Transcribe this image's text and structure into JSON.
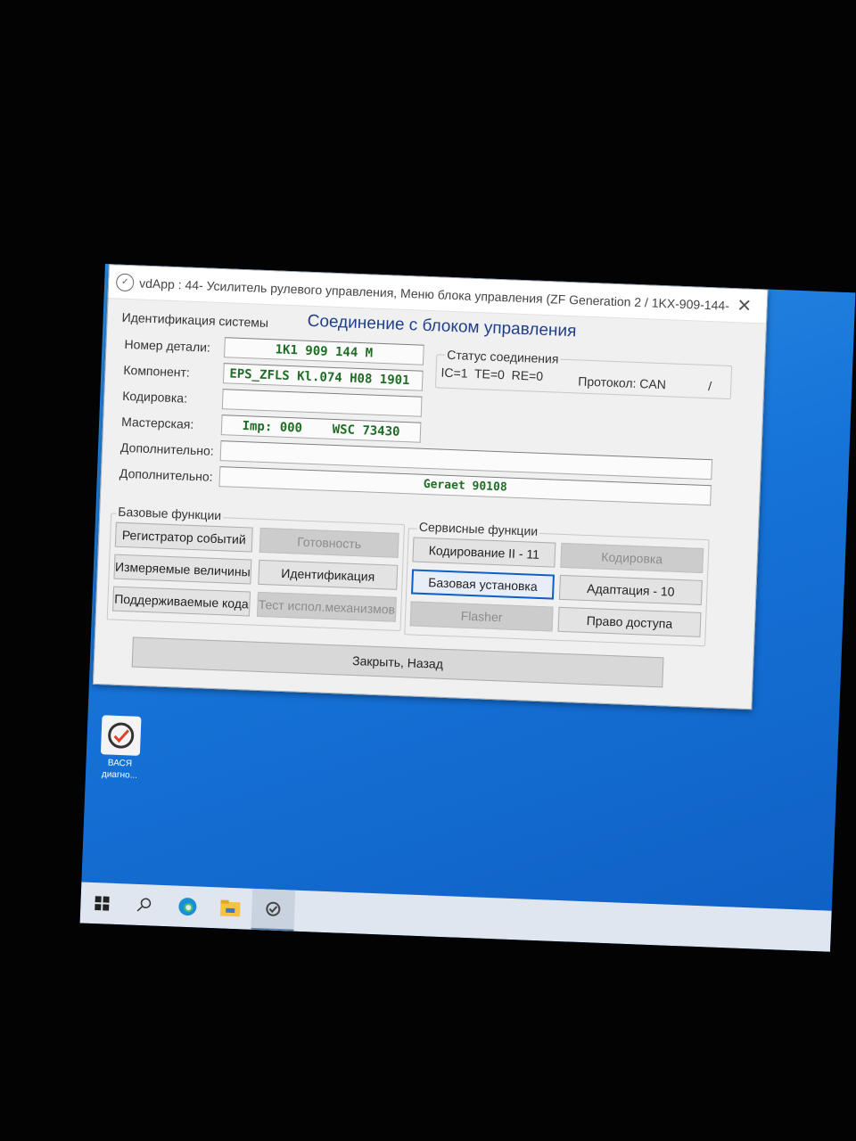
{
  "window": {
    "title": "vdApp : 44- Усилитель рулевого управления,  Меню блока управления (ZF Generation 2 / 1KX-909-144-...",
    "close_glyph": "✕",
    "heading": "Соединение с блоком управления"
  },
  "identification": {
    "group_label": "Идентификация системы",
    "rows": [
      {
        "label": "Номер детали:",
        "value": "1K1 909 144 M"
      },
      {
        "label": "Компонент:",
        "value": "EPS_ZFLS Kl.074 H08 1901"
      },
      {
        "label": "Кодировка:",
        "value": ""
      },
      {
        "label": "Мастерская:",
        "value": "Imp: 000    WSC 73430"
      },
      {
        "label": "Дополнительно:",
        "value": ""
      },
      {
        "label": "Дополнительно:",
        "value": "Geraet 90108"
      }
    ]
  },
  "connection_status": {
    "group_label": "Статус соединения",
    "counters": "IC=1  TE=0  RE=0",
    "protocol": "Протокол: CAN",
    "activity": "/"
  },
  "basic_functions": {
    "group_label": "Базовые функции",
    "buttons": [
      {
        "label": "Регистратор событий",
        "enabled": true
      },
      {
        "label": "Готовность",
        "enabled": false
      },
      {
        "label": "Измеряемые величины",
        "enabled": true
      },
      {
        "label": "Идентификация",
        "enabled": true
      },
      {
        "label": "Поддерживаемые кода",
        "enabled": true
      },
      {
        "label": "Тест испол.механизмов",
        "enabled": false
      }
    ]
  },
  "service_functions": {
    "group_label": "Сервисные функции",
    "buttons": [
      {
        "label": "Кодирование II - 11",
        "enabled": true
      },
      {
        "label": "Кодировка",
        "enabled": false
      },
      {
        "label": "Базовая установка",
        "enabled": true,
        "focused": true
      },
      {
        "label": "Адаптация - 10",
        "enabled": true
      },
      {
        "label": "Flasher",
        "enabled": false
      },
      {
        "label": "Право доступа",
        "enabled": true
      }
    ]
  },
  "close_button": {
    "label": "Закрыть, Назад"
  },
  "desktop": {
    "icon_label_line1": "ВАСЯ",
    "icon_label_line2": "диагно..."
  },
  "taskbar": {
    "items": [
      "windows-start",
      "search",
      "edge-browser",
      "file-explorer",
      "vdapp"
    ],
    "active": "vdapp"
  },
  "colors": {
    "field_text": "#1f6d25",
    "heading": "#1f3f8a",
    "focus_border": "#0d5fc7",
    "desktop": "#1673d8"
  }
}
